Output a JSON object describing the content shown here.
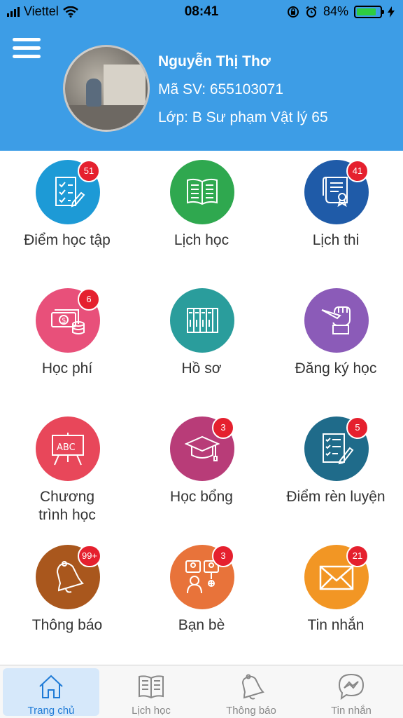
{
  "status_bar": {
    "carrier": "Viettel",
    "time": "08:41",
    "battery_percent": "84%",
    "battery_level": 0.84
  },
  "profile": {
    "name": "Nguyễn Thị Thơ",
    "student_id": "Mã SV: 655103071",
    "class": "Lớp: B Sư phạm Vật lý 65"
  },
  "tiles": [
    {
      "label": "Điểm học tập",
      "badge": "51",
      "color": "#1d9ad6",
      "icon": "checklist-icon"
    },
    {
      "label": "Lịch học",
      "badge": "",
      "color": "#2fa84f",
      "icon": "open-book-icon"
    },
    {
      "label": "Lịch thi",
      "badge": "41",
      "color": "#1f5ba8",
      "icon": "certificate-icon"
    },
    {
      "label": "Học phí",
      "badge": "6",
      "color": "#e8507a",
      "icon": "money-icon"
    },
    {
      "label": "Hồ sơ",
      "badge": "",
      "color": "#2a9d9c",
      "icon": "binders-icon"
    },
    {
      "label": "Đăng ký học",
      "badge": "",
      "color": "#8b5bb8",
      "icon": "hand-pen-icon"
    },
    {
      "label": "Chương trình học",
      "badge": "",
      "color": "#e8475a",
      "icon": "abc-board-icon"
    },
    {
      "label": "Học bổng",
      "badge": "3",
      "color": "#b83c78",
      "icon": "graduation-cap-icon"
    },
    {
      "label": "Điểm rèn luyện",
      "badge": "5",
      "color": "#1f6b8a",
      "icon": "checklist-pen-icon"
    },
    {
      "label": "Thông báo",
      "badge": "99+",
      "color": "#a9571d",
      "icon": "bell-icon"
    },
    {
      "label": "Bạn bè",
      "badge": "3",
      "color": "#e8733a",
      "icon": "friends-icon"
    },
    {
      "label": "Tin nhắn",
      "badge": "21",
      "color": "#f29624",
      "icon": "envelope-icon"
    }
  ],
  "tabbar": [
    {
      "label": "Trang chủ",
      "icon": "home-icon",
      "active": true
    },
    {
      "label": "Lịch học",
      "icon": "book-icon",
      "active": false
    },
    {
      "label": "Thông báo",
      "icon": "bell-icon",
      "active": false
    },
    {
      "label": "Tin nhắn",
      "icon": "messenger-icon",
      "active": false
    }
  ]
}
